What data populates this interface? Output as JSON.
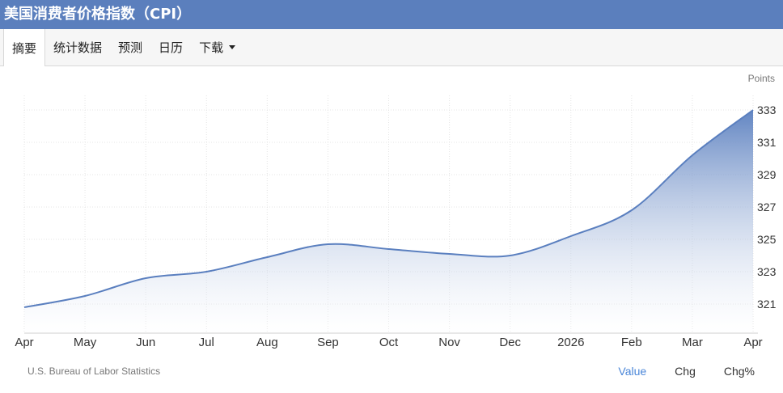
{
  "page_title": "美国消费者价格指数（CPI）",
  "tabs": [
    {
      "label": "摘要",
      "active": true
    },
    {
      "label": "统计数据",
      "active": false
    },
    {
      "label": "预测",
      "active": false
    },
    {
      "label": "日历",
      "active": false
    },
    {
      "label": "下载",
      "active": false
    }
  ],
  "colors": {
    "header": "#5b7fbd",
    "line": "#5a7fbf",
    "fill_top": "#5a7fbf",
    "fill_bottom": "#ffffff",
    "active_toggle": "#4a86d8"
  },
  "chart_data": {
    "type": "area",
    "ylabel": "Points",
    "x_ticks": [
      "Apr",
      "May",
      "Jun",
      "Jul",
      "Aug",
      "Sep",
      "Oct",
      "Nov",
      "Dec",
      "2026",
      "Feb",
      "Mar",
      "Apr"
    ],
    "values": [
      320.8,
      321.5,
      322.6,
      323.0,
      323.9,
      324.7,
      324.4,
      324.1,
      324.0,
      325.2,
      326.8,
      330.2,
      333.0
    ],
    "y_ticks": [
      321,
      323,
      325,
      327,
      329,
      331,
      333
    ],
    "ylim": [
      319.2,
      333.9
    ],
    "grid": true,
    "y_axis_position": "right"
  },
  "source": "U.S. Bureau of Labor Statistics",
  "view_toggle": [
    {
      "label": "Value",
      "active": true
    },
    {
      "label": "Chg",
      "active": false
    },
    {
      "label": "Chg%",
      "active": false
    }
  ]
}
